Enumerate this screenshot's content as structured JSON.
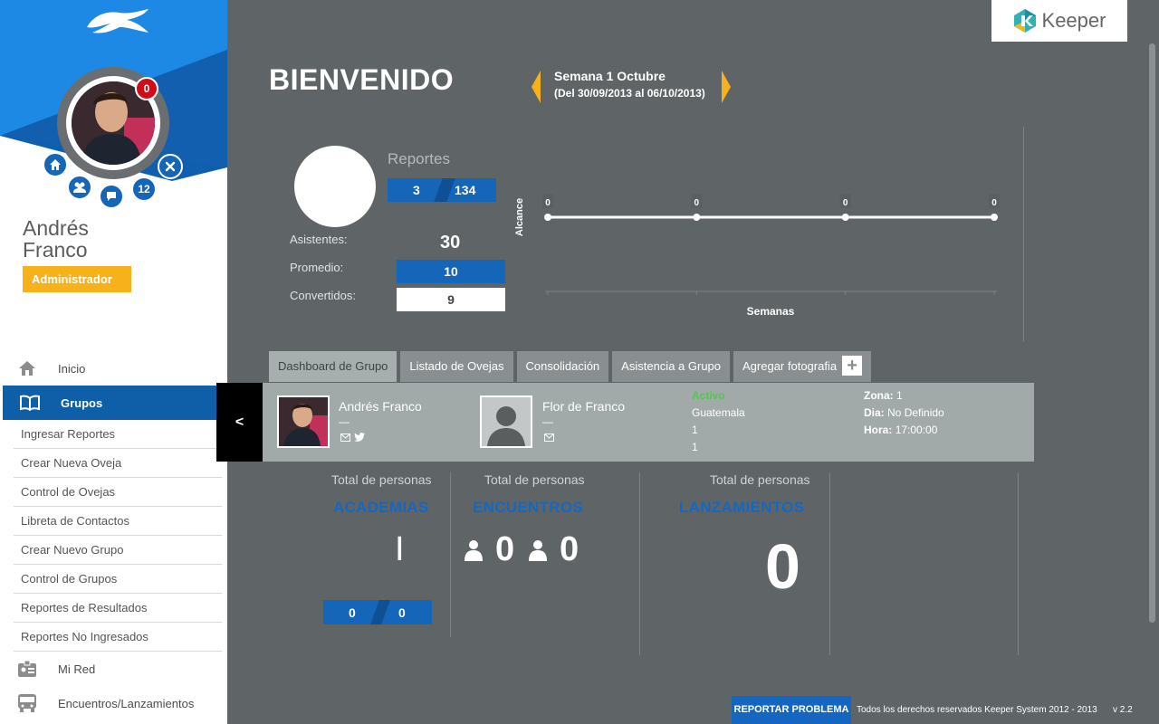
{
  "user": {
    "name_line1": "Andrés",
    "name_line2": "Franco",
    "role": "Administrador",
    "notifications": "0",
    "messages_count": "12"
  },
  "nav": {
    "items": [
      {
        "label": "Inicio",
        "icon": "home-icon"
      },
      {
        "label": "Grupos",
        "icon": "book-icon"
      }
    ],
    "sub_items": [
      "Ingresar Reportes",
      "Crear Nueva Oveja",
      "Control de Ovejas",
      "Libreta de Contactos",
      "Crear Nuevo Grupo",
      "Control de Grupos",
      "Reportes de Resultados",
      "Reportes No Ingresados"
    ],
    "bottom_items": [
      {
        "label": "Mi Red",
        "icon": "id-card-icon"
      },
      {
        "label": "Encuentros/Lanzamientos",
        "icon": "bus-icon"
      }
    ]
  },
  "brand": {
    "name": "Keeper"
  },
  "header": {
    "welcome": "BIENVENIDO",
    "week_title": "Semana 1 Octubre",
    "week_range": "(Del 30/09/2013 al 06/10/2013)"
  },
  "stats": {
    "reportes_label": "Reportes",
    "reportes_a": "3",
    "reportes_b": "134",
    "asistentes_label": "Asistentes:",
    "asistentes_value": "30",
    "promedio_label": "Promedio:",
    "promedio_value": "10",
    "convertidos_label": "Convertidos:",
    "convertidos_value": "9"
  },
  "chart_data": {
    "type": "line",
    "xlabel": "Semanas",
    "ylabel": "Alcance",
    "x": [
      "",
      "",
      "",
      ""
    ],
    "series": [
      {
        "values": [
          0,
          0,
          0,
          0
        ]
      }
    ],
    "data_labels": [
      "0",
      "0",
      "0",
      "0"
    ]
  },
  "tabs": [
    "Dashboard de Grupo",
    "Listado de Ovejas",
    "Consolidación",
    "Asistencia a Grupo",
    "Agregar fotografia"
  ],
  "group": {
    "collapse_label": "<",
    "leader1_name": "Andrés Franco",
    "leader1_dash": "—",
    "leader2_name": "Flor de Franco",
    "leader2_dash": "—",
    "status": "Activo",
    "location": "Guatemala",
    "value1": "1",
    "value2": "1",
    "zona_label": "Zona:",
    "zona_value": "1",
    "dia_label": "Dia:",
    "dia_value": "No Definido",
    "hora_label": "Hora:",
    "hora_value": "17:00:00",
    "status_color": "#4ec94e"
  },
  "totals": {
    "label": "Total de personas",
    "academias_title": "ACADEMIAS",
    "academias_value": "I",
    "academias_a": "0",
    "academias_b": "0",
    "encuentros_title": "ENCUENTROS",
    "encuentros_men": "0",
    "encuentros_women": "0",
    "lanzamientos_title": "LANZAMIENTOS",
    "lanzamientos_value": "0"
  },
  "footer": {
    "report_button": "REPORTAR PROBLEMA",
    "copyright": "Todos los derechos reservados Keeper System 2012 - 2013",
    "version": "v 2.2"
  },
  "colors": {
    "primary_blue": "#1565b8",
    "background": "#5f6566",
    "accent_yellow": "#f7b11b",
    "alert_red": "#d00c18"
  }
}
